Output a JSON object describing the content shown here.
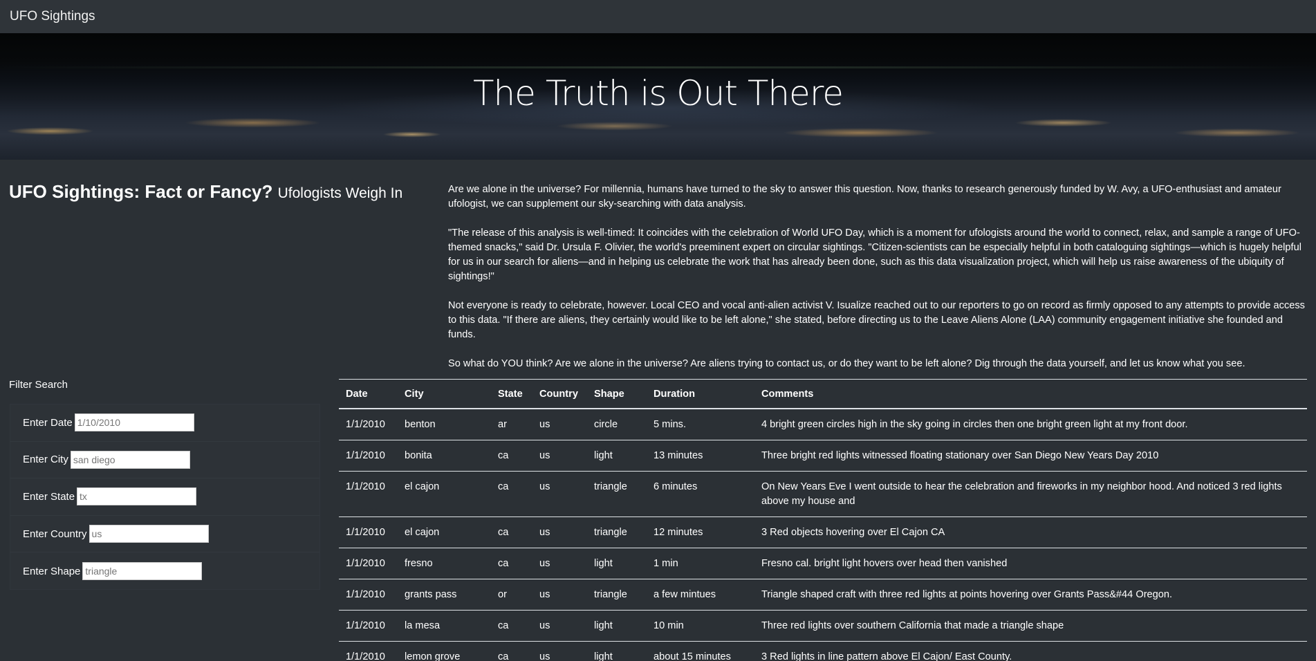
{
  "navbar": {
    "brand": "UFO Sightings"
  },
  "hero": {
    "title": "The Truth is Out There"
  },
  "headline": {
    "main": "UFO Sightings: Fact or Fancy?",
    "sub": "Ufologists Weigh In"
  },
  "article": {
    "paragraphs": [
      "Are we alone in the universe? For millennia, humans have turned to the sky to answer this question. Now, thanks to research generously funded by W. Avy, a UFO-enthusiast and amateur ufologist, we can supplement our sky-searching with data analysis.",
      "\"The release of this analysis is well-timed: It coincides with the celebration of World UFO Day, which is a moment for ufologists around the world to connect, relax, and sample a range of UFO-themed snacks,\" said Dr. Ursula F. Olivier, the world's preeminent expert on circular sightings. \"Citizen-scientists can be especially helpful in both cataloguing sightings—which is hugely helpful for us in our search for aliens—and in helping us celebrate the work that has already been done, such as this data visualization project, which will help us raise awareness of the ubiquity of sightings!\"",
      "Not everyone is ready to celebrate, however. Local CEO and vocal anti-alien activist V. Isualize reached out to our reporters to go on record as firmly opposed to any attempts to provide access to this data. \"If there are aliens, they certainly would like to be left alone,\" she stated, before directing us to the Leave Aliens Alone (LAA) community engagement initiative she founded and funds.",
      "So what do YOU think? Are we alone in the universe? Are aliens trying to contact us, or do they want to be left alone? Dig through the data yourself, and let us know what you see."
    ]
  },
  "filters": {
    "title": "Filter Search",
    "date": {
      "label": "Enter Date",
      "placeholder": "1/10/2010"
    },
    "city": {
      "label": "Enter City",
      "placeholder": "san diego"
    },
    "state": {
      "label": "Enter State",
      "placeholder": "tx"
    },
    "country": {
      "label": "Enter Country",
      "placeholder": "us"
    },
    "shape": {
      "label": "Enter Shape",
      "placeholder": "triangle"
    }
  },
  "table": {
    "headers": [
      "Date",
      "City",
      "State",
      "Country",
      "Shape",
      "Duration",
      "Comments"
    ],
    "rows": [
      [
        "1/1/2010",
        "benton",
        "ar",
        "us",
        "circle",
        "5 mins.",
        "4 bright green circles high in the sky going in circles then one bright green light at my front door."
      ],
      [
        "1/1/2010",
        "bonita",
        "ca",
        "us",
        "light",
        "13 minutes",
        "Three bright red lights witnessed floating stationary over San Diego New Years Day 2010"
      ],
      [
        "1/1/2010",
        "el cajon",
        "ca",
        "us",
        "triangle",
        "6 minutes",
        "On New Years Eve I went outside to hear the celebration and fireworks in my neighbor hood. And noticed 3 red lights above my house and"
      ],
      [
        "1/1/2010",
        "el cajon",
        "ca",
        "us",
        "triangle",
        "12 minutes",
        "3 Red objects hovering over El Cajon CA"
      ],
      [
        "1/1/2010",
        "fresno",
        "ca",
        "us",
        "light",
        "1 min",
        "Fresno cal. bright light hovers over head then vanished"
      ],
      [
        "1/1/2010",
        "grants pass",
        "or",
        "us",
        "triangle",
        "a few mintues",
        "Triangle shaped craft with three red lights at points hovering over Grants Pass&#44 Oregon."
      ],
      [
        "1/1/2010",
        "la mesa",
        "ca",
        "us",
        "light",
        "10 min",
        "Three red lights over southern California that made a triangle shape"
      ],
      [
        "1/1/2010",
        "lemon grove",
        "ca",
        "us",
        "light",
        "about 15 minutes",
        "3 Red lights in line pattern above El Cajon/ East County."
      ]
    ]
  }
}
